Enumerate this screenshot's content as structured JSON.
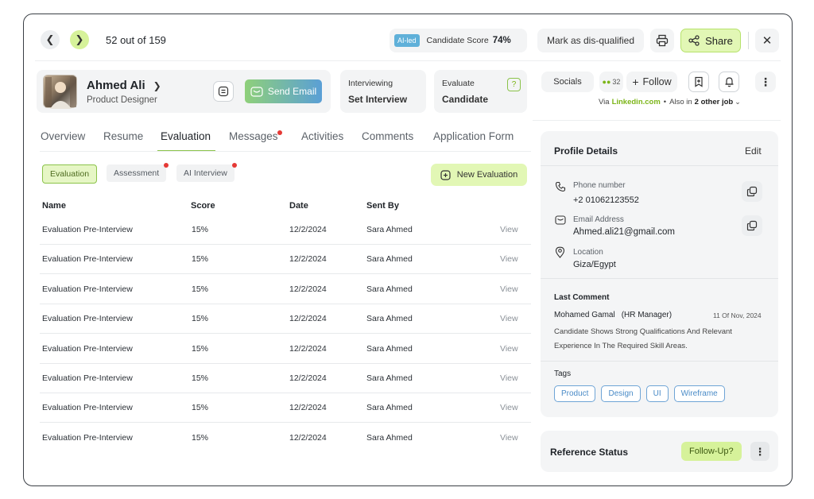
{
  "nav": {
    "counter": "52 out of 159"
  },
  "score": {
    "ai_badge": "AI-led",
    "label": "Candidate Score",
    "value": "74%"
  },
  "header_actions": {
    "disqualify": "Mark as dis-qualified",
    "share": "Share"
  },
  "candidate": {
    "name": "Ahmed Ali",
    "role": "Product Designer",
    "send_email": "Send Email"
  },
  "stage": {
    "label": "Interviewing",
    "value": "Set Interview"
  },
  "evaluate": {
    "label": "Evaluate",
    "value": "Candidate",
    "badge": "?"
  },
  "socials": {
    "label": "Socials",
    "count": "32",
    "follow": "Follow",
    "via_prefix": "Via",
    "via_link": "Linkedin.com",
    "also_prefix": "Also in",
    "also_jobs": "2 other job"
  },
  "tabs": [
    "Overview",
    "Resume",
    "Evaluation",
    "Messages",
    "Activities",
    "Comments",
    "Application Form"
  ],
  "subtabs": [
    "Evaluation",
    "Assessment",
    "AI Interview"
  ],
  "new_evaluation": "New Evaluation",
  "table": {
    "headers": [
      "Name",
      "Score",
      "Date",
      "Sent By"
    ],
    "rows": [
      {
        "name": "Evaluation Pre-Interview",
        "score": "15%",
        "date": "12/2/2024",
        "sent_by": "Sara Ahmed",
        "action": "View"
      },
      {
        "name": "Evaluation Pre-Interview",
        "score": "15%",
        "date": "12/2/2024",
        "sent_by": "Sara Ahmed",
        "action": "View"
      },
      {
        "name": "Evaluation Pre-Interview",
        "score": "15%",
        "date": "12/2/2024",
        "sent_by": "Sara Ahmed",
        "action": "View"
      },
      {
        "name": "Evaluation Pre-Interview",
        "score": "15%",
        "date": "12/2/2024",
        "sent_by": "Sara Ahmed",
        "action": "View"
      },
      {
        "name": "Evaluation Pre-Interview",
        "score": "15%",
        "date": "12/2/2024",
        "sent_by": "Sara Ahmed",
        "action": "View"
      },
      {
        "name": "Evaluation Pre-Interview",
        "score": "15%",
        "date": "12/2/2024",
        "sent_by": "Sara Ahmed",
        "action": "View"
      },
      {
        "name": "Evaluation Pre-Interview",
        "score": "15%",
        "date": "12/2/2024",
        "sent_by": "Sara Ahmed",
        "action": "View"
      },
      {
        "name": "Evaluation Pre-Interview",
        "score": "15%",
        "date": "12/2/2024",
        "sent_by": "Sara Ahmed",
        "action": "View"
      }
    ]
  },
  "profile": {
    "title": "Profile Details",
    "edit": "Edit",
    "phone_label": "Phone number",
    "phone": "+2 01062123552",
    "email_label": "Email Address",
    "email": "Ahmed.ali21@gmail.com",
    "location_label": "Location",
    "location": "Giza/Egypt"
  },
  "last_comment": {
    "title": "Last Comment",
    "author": "Mohamed Gamal",
    "author_role": "(HR Manager)",
    "date": "11 Of Nov, 2024",
    "text_line1": "Candidate Shows Strong Qualifications And Relevant",
    "text_line2": "Experience In The Required Skill Areas."
  },
  "tags": {
    "title": "Tags",
    "items": [
      "Product",
      "Design",
      "UI",
      "Wireframe"
    ]
  },
  "reference": {
    "title": "Reference Status",
    "status": "Follow-Up?"
  },
  "colors": {
    "accent_green": "#d6f29a",
    "green_text": "#7cb518",
    "email_gradient_start": "#8fd07a",
    "email_gradient_end": "#5a9fd6",
    "notify_red": "#e53935"
  }
}
